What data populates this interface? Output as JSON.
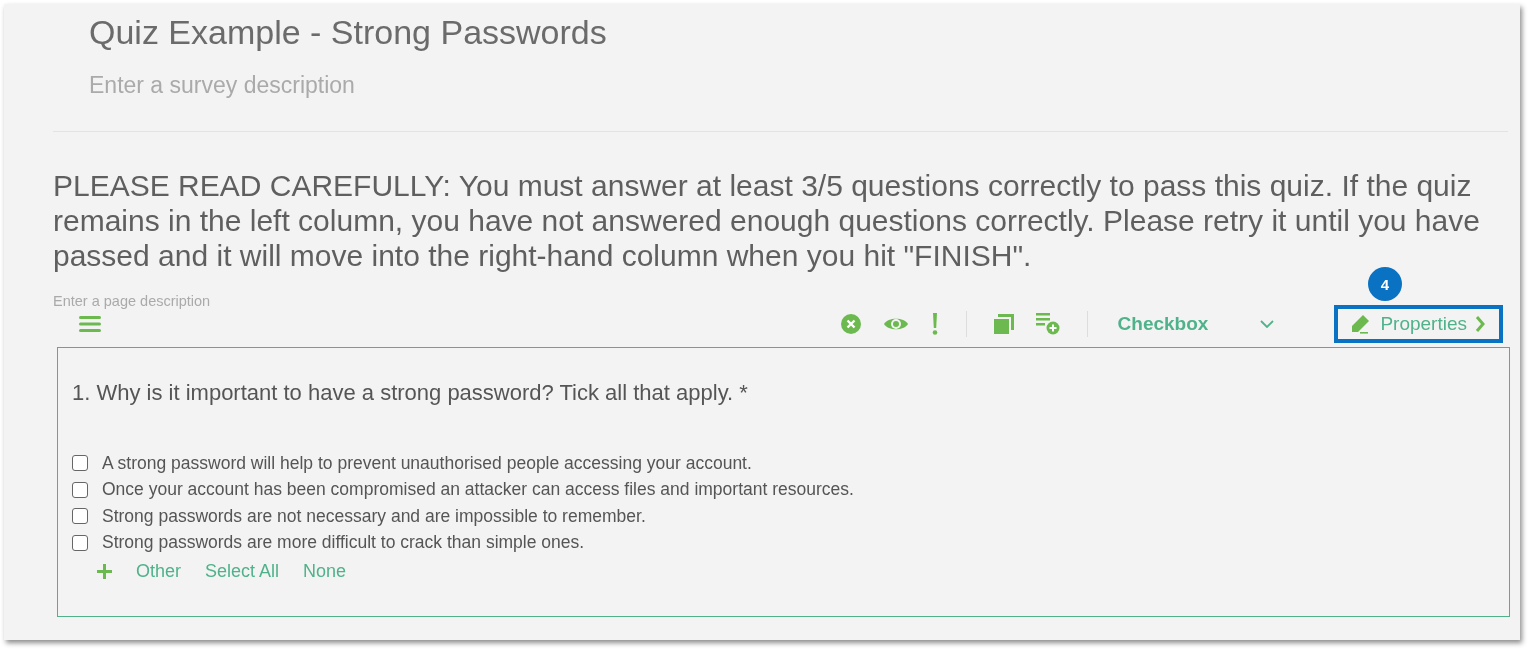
{
  "survey": {
    "title": "Quiz Example - Strong Passwords",
    "description_placeholder": "Enter a survey description"
  },
  "page": {
    "title": "PLEASE READ CAREFULLY: You must answer at least 3/5 questions correctly to pass this quiz. If the quiz remains in the left column, you have not answered enough questions correctly. Please retry it until you have passed and it will move into the right-hand column when you hit \"FINISH\".",
    "description_placeholder": "Enter a page description"
  },
  "toolbar": {
    "question_type": "Checkbox",
    "properties_label": "Properties",
    "callout": "4",
    "highlighted": true
  },
  "question": {
    "title": "1. Why is it important to have a strong password? Tick all that apply. *",
    "choices": [
      {
        "label": "A strong password will help to prevent unauthorised people accessing your account.",
        "checked": false
      },
      {
        "label": "Once your account has been compromised an attacker can access files and important resources.",
        "checked": false
      },
      {
        "label": "Strong passwords are not necessary and are impossible to remember.",
        "checked": false
      },
      {
        "label": "Strong passwords are more difficult to crack than simple ones.",
        "checked": false
      }
    ],
    "actions": [
      "Other",
      "Select All",
      "None"
    ]
  }
}
